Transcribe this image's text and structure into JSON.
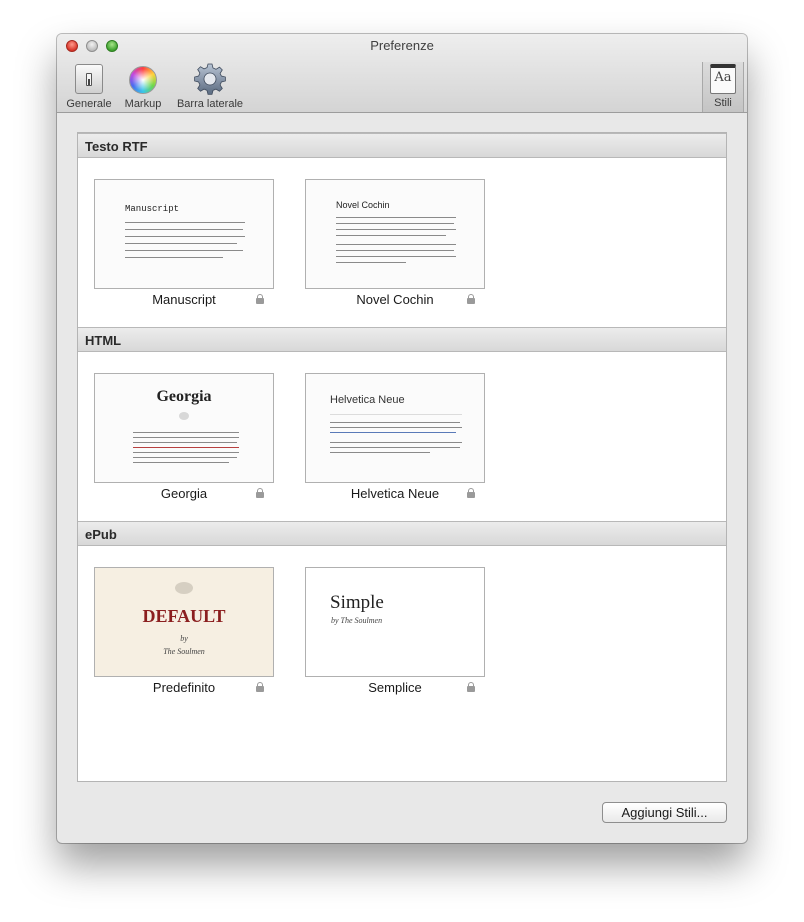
{
  "window": {
    "title": "Preferenze"
  },
  "toolbar": {
    "items": [
      {
        "label": "Generale",
        "icon": "general-switch-icon"
      },
      {
        "label": "Markup",
        "icon": "color-wheel-icon"
      },
      {
        "label": "Barra laterale",
        "icon": "gear-icon"
      }
    ],
    "right_item": {
      "label": "Stili",
      "icon": "styles-icon",
      "icon_text": "Aa",
      "selected": true
    }
  },
  "sections": [
    {
      "title": "Testo RTF",
      "styles": [
        {
          "name": "Manuscript",
          "thumb_title": "Manuscript",
          "locked": true
        },
        {
          "name": "Novel Cochin",
          "thumb_title": "Novel Cochin",
          "locked": true
        }
      ]
    },
    {
      "title": "HTML",
      "styles": [
        {
          "name": "Georgia",
          "thumb_title": "Georgia",
          "locked": true
        },
        {
          "name": "Helvetica Neue",
          "thumb_title": "Helvetica Neue",
          "locked": true
        }
      ]
    },
    {
      "title": "ePub",
      "styles": [
        {
          "name": "Predefinito",
          "thumb_title": "DEFAULT",
          "thumb_by": "by",
          "thumb_author": "The Soulmen",
          "locked": true
        },
        {
          "name": "Semplice",
          "thumb_title": "Simple",
          "thumb_author": "by The Soulmen",
          "locked": true
        }
      ]
    }
  ],
  "buttons": {
    "add_styles": "Aggiungi Stili..."
  },
  "colors": {
    "default_thumb_bg": "#f6efe2",
    "default_thumb_title": "#8b1f1f"
  }
}
